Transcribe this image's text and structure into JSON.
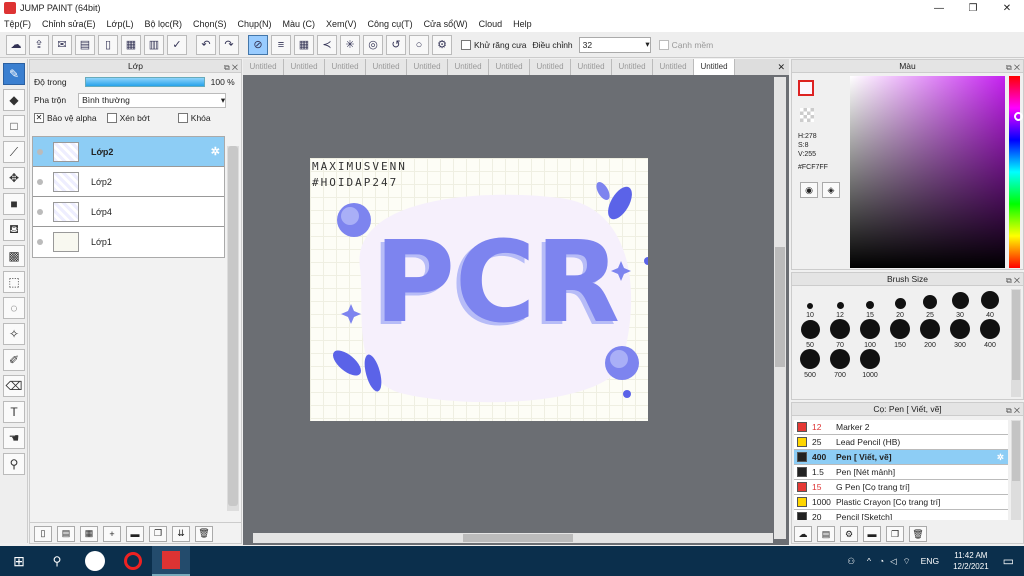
{
  "app": {
    "title": "JUMP PAINT (64bit)"
  },
  "menu": [
    "Tệp(F)",
    "Chỉnh sửa(E)",
    "Lớp(L)",
    "Bộ lọc(R)",
    "Chọn(S)",
    "Chụp(N)",
    "Màu (C)",
    "Xem(V)",
    "Công cụ(T)",
    "Cửa sổ(W)",
    "Cloud",
    "Help"
  ],
  "toolbar": {
    "antialias_label": "Khử răng cưa",
    "smooth_label": "Điều chỉnh",
    "smooth_value": "32",
    "edge_label": "Cạnh mềm"
  },
  "layer_panel": {
    "title": "Lớp",
    "opacity_label": "Độ trong",
    "opacity_value": "100 %",
    "opacity": 1.0,
    "blend_label": "Pha trộn",
    "blend_value": "Bình thường",
    "protect_alpha": "Bảo vệ alpha",
    "clipping": "Xén bớt",
    "lock": "Khóa",
    "layers": [
      {
        "name": "Lớp2",
        "selected": true
      },
      {
        "name": "Lớp2",
        "selected": false
      },
      {
        "name": "Lớp4",
        "selected": false
      },
      {
        "name": "Lớp1",
        "selected": false
      }
    ]
  },
  "canvas": {
    "tabs": [
      "Untitled",
      "Untitled",
      "Untitled",
      "Untitled",
      "Untitled",
      "Untitled",
      "Untitled",
      "Untitled",
      "Untitled",
      "Untitled",
      "Untitled",
      "Untitled"
    ],
    "artwork_text": "PCR",
    "handle_line1": "MAXIMUSVENN",
    "handle_line2": "#HOIDAP247"
  },
  "color_panel": {
    "title": "Màu",
    "h": "H:278",
    "s": "S:8",
    "v": "V:255",
    "hex": "#FCF7FF",
    "primary": "#FCF7FF"
  },
  "brush_size": {
    "title": "Brush Size",
    "sizes": [
      "10",
      "12",
      "15",
      "20",
      "25",
      "30",
      "40",
      "50",
      "70",
      "100",
      "150",
      "200",
      "300",
      "400",
      "500",
      "700",
      "1000"
    ]
  },
  "brush_panel": {
    "title": "Cọ: Pen [ Viết, vẽ]",
    "items": [
      {
        "color": "#e53935",
        "size": "12",
        "name": "Marker 2"
      },
      {
        "color": "#ffd600",
        "size": "25",
        "name": "Lead Pencil (HB)"
      },
      {
        "color": "#222222",
        "size": "400",
        "name": "Pen [ Viết, vẽ]",
        "selected": true
      },
      {
        "color": "#222222",
        "size": "1.5",
        "name": "Pen [Nét mảnh]"
      },
      {
        "color": "#e53935",
        "size": "15",
        "name": "G Pen [Cọ trang trí]"
      },
      {
        "color": "#ffd600",
        "size": "1000",
        "name": "Plastic Crayon [Cọ trang trí]"
      },
      {
        "color": "#222222",
        "size": "20",
        "name": "Pencil [Sketch]"
      }
    ]
  },
  "taskbar": {
    "language": "ENG",
    "time": "11:42 AM",
    "date": "12/2/2021"
  }
}
